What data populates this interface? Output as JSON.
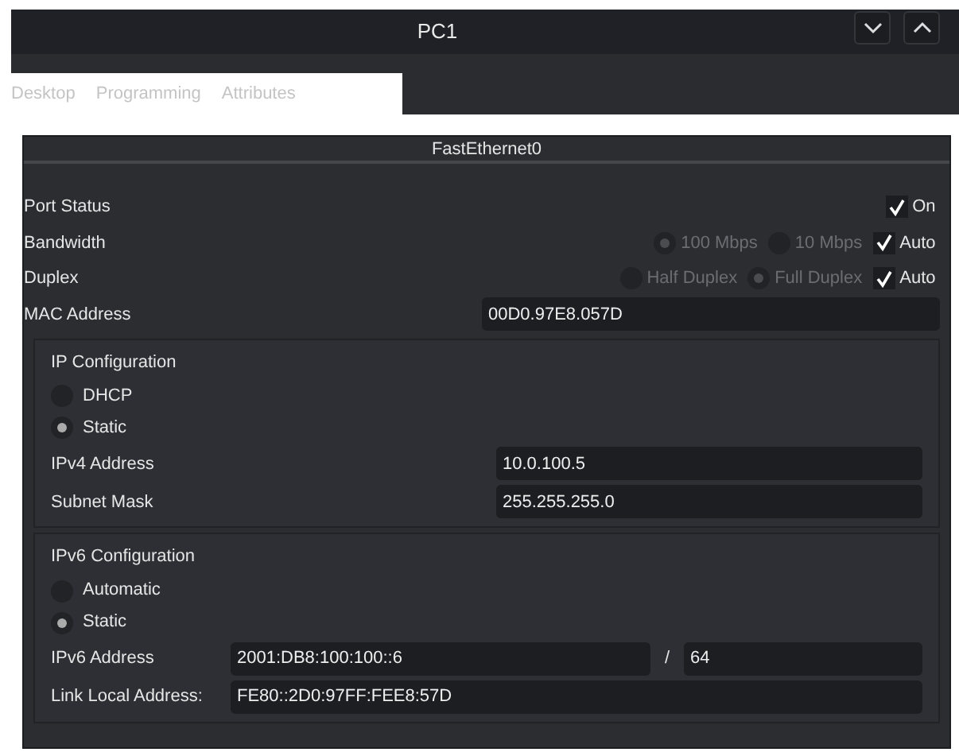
{
  "window": {
    "title": "PC1"
  },
  "tabs": [
    {
      "label": "Desktop",
      "selected": false
    },
    {
      "label": "Programming",
      "selected": false
    },
    {
      "label": "Attributes",
      "selected": false
    }
  ],
  "interface": {
    "title": "FastEthernet0",
    "settings": [
      {
        "kind": "options",
        "label": "Port Status",
        "options": [
          {
            "kind": "checkbox",
            "label": "On",
            "checked": true,
            "disabled": false
          }
        ]
      },
      {
        "kind": "options",
        "label": "Bandwidth",
        "options": [
          {
            "kind": "radio",
            "label": "100 Mbps",
            "selected": true,
            "disabled": true
          },
          {
            "kind": "radio",
            "label": "10 Mbps",
            "selected": false,
            "disabled": true
          },
          {
            "kind": "checkbox",
            "label": "Auto",
            "checked": true,
            "disabled": false
          }
        ]
      },
      {
        "kind": "options",
        "label": "Duplex",
        "options": [
          {
            "kind": "radio",
            "label": "Half Duplex",
            "selected": false,
            "disabled": true
          },
          {
            "kind": "radio",
            "label": "Full Duplex",
            "selected": true,
            "disabled": true
          },
          {
            "kind": "checkbox",
            "label": "Auto",
            "checked": true,
            "disabled": false
          }
        ]
      },
      {
        "kind": "field",
        "label": "MAC Address",
        "value": "00D0.97E8.057D"
      }
    ],
    "groups": [
      {
        "kind": "ipv4",
        "title": "IP Configuration",
        "modes": [
          {
            "label": "DHCP",
            "selected": false
          },
          {
            "label": "Static",
            "selected": true
          }
        ],
        "fields": [
          {
            "label": "IPv4 Address",
            "value": "10.0.100.5"
          },
          {
            "label": "Subnet Mask",
            "value": "255.255.255.0"
          }
        ]
      },
      {
        "kind": "ipv6",
        "title": "IPv6 Configuration",
        "modes": [
          {
            "label": "Automatic",
            "selected": false
          },
          {
            "label": "Static",
            "selected": true
          }
        ],
        "fields": [
          {
            "label": "IPv6 Address",
            "value": "2001:DB8:100:100::6",
            "separator": "/",
            "prefix": "64"
          },
          {
            "label": "Link Local Address:",
            "value": "FE80::2D0:97FF:FEE8:57D"
          }
        ]
      }
    ]
  }
}
